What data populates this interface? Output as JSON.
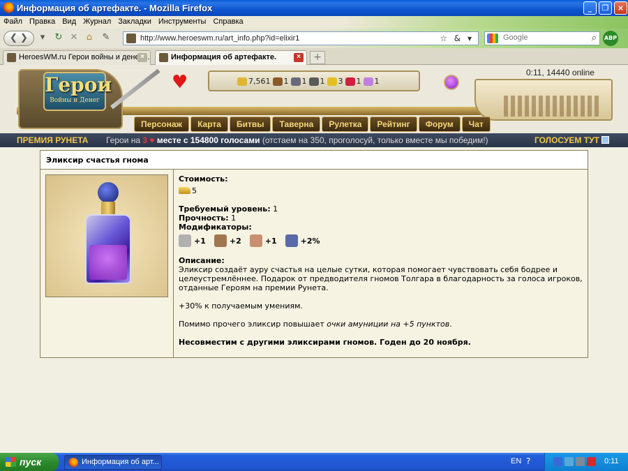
{
  "window": {
    "title": "Информация об артефакте. - Mozilla Firefox"
  },
  "menu": [
    "Файл",
    "Правка",
    "Вид",
    "Журнал",
    "Закладки",
    "Инструменты",
    "Справка"
  ],
  "navbar": {
    "url": "http://www.heroeswm.ru/art_info.php?id=elixir1",
    "search_placeholder": "Google",
    "abp_label": "ABP"
  },
  "tabs": [
    {
      "label": "HeroesWM.ru Герои войны и денег. ..."
    },
    {
      "label": "Информация об артефакте."
    }
  ],
  "game": {
    "logo_title": "Герои",
    "logo_subtitle": "Войны и Денег",
    "online": "0:11, 14440 online",
    "resources": [
      {
        "value": "7,561",
        "icon": "gold-icon",
        "color": "#e2b534"
      },
      {
        "value": "1",
        "icon": "wood-icon",
        "color": "#8a5a2a"
      },
      {
        "value": "1",
        "icon": "ore-icon",
        "color": "#6a6a7a"
      },
      {
        "value": "1",
        "icon": "mercury-icon",
        "color": "#5a5a5a"
      },
      {
        "value": "3",
        "icon": "sulfur-icon",
        "color": "#e6c020"
      },
      {
        "value": "1",
        "icon": "crystal-icon",
        "color": "#d02040"
      },
      {
        "value": "1",
        "icon": "gems-icon",
        "color": "#c080e0"
      }
    ],
    "nav": [
      "Персонаж",
      "Карта",
      "Битвы",
      "Таверна",
      "Рулетка",
      "Рейтинг",
      "Форум",
      "Чат"
    ]
  },
  "runet": {
    "left": "ПРЕМИЯ РУНЕТА",
    "text_pre": "Герои на ",
    "place": "3",
    "text_mid": " месте с 154800 голосами",
    "text_post": " (отстаем на 350, проголосуй, только вместе мы победим!)",
    "right": "ГОЛОСУЕМ ТУТ"
  },
  "artifact": {
    "name": "Эликсир счастья гнома",
    "cost_label": "Стоимость:",
    "cost_value": "5",
    "level_label": "Требуемый уровень:",
    "level_value": "1",
    "durability_label": "Прочность:",
    "durability_value": "1",
    "modifiers_label": "Модификаторы:",
    "modifiers": [
      {
        "icon": "attack-icon",
        "value": "+1",
        "color": "#b0b0b0"
      },
      {
        "icon": "defense-icon",
        "value": "+2",
        "color": "#a07850"
      },
      {
        "icon": "spellbook-icon",
        "value": "+1",
        "color": "#c89070"
      },
      {
        "icon": "luck-icon",
        "value": "+2%",
        "color": "#5a6aa8"
      }
    ],
    "description_label": "Описание:",
    "description": "Эликсир создаёт ауру счастья на целые сутки, которая помогает чувствовать себя бодрее и целеустремлённее. Подарок от предводителя гномов Толгара в благодарность за голоса игроков, отданные Героям на премии Рунета.",
    "bonus": "+30% к получаемым умениям.",
    "extra_pre": "Помимо прочего эликсир повышает ",
    "extra_em": "очки амуниции на +5 пунктов",
    "extra_post": ".",
    "warning": "Несовместим с другими эликсирами гномов. Годен до 20 ноября."
  },
  "taskbar": {
    "start": "пуск",
    "task": "Информация об арт...",
    "lang": "EN",
    "clock": "0:11"
  }
}
